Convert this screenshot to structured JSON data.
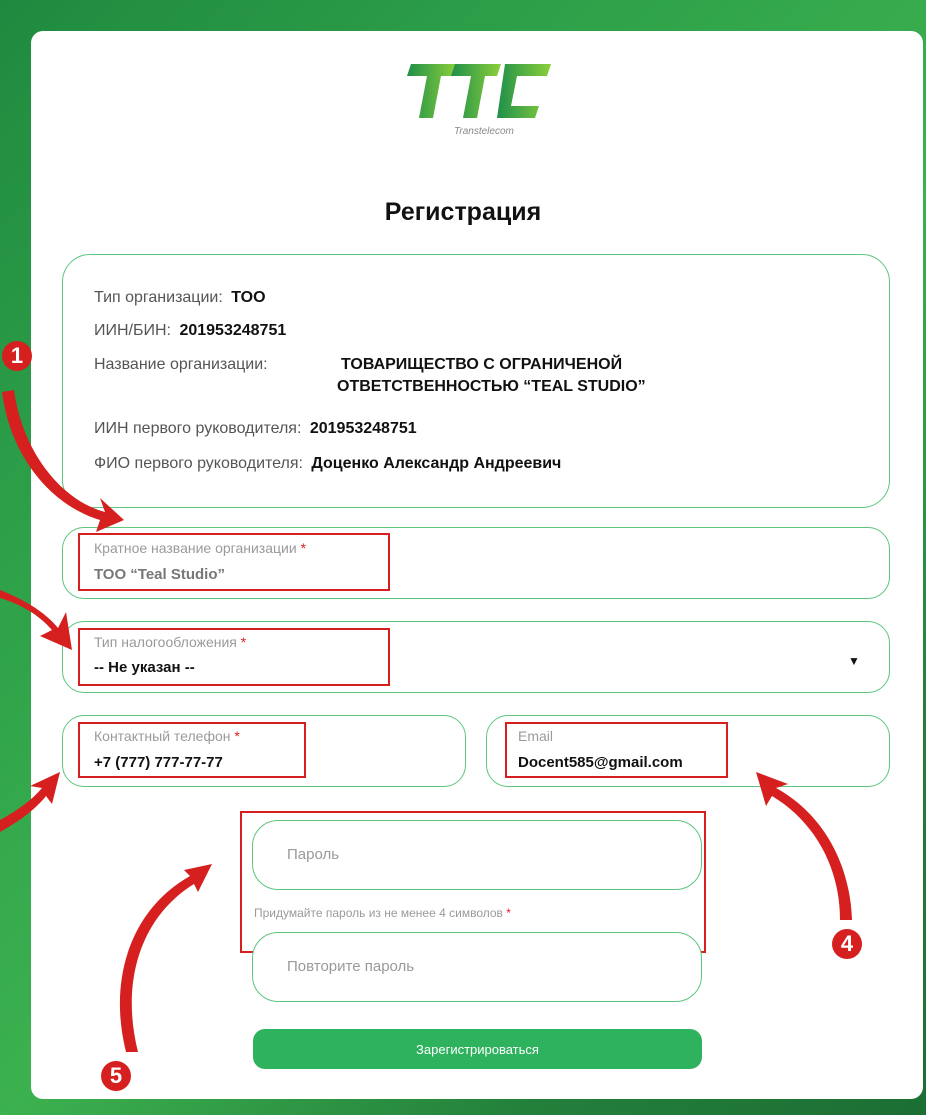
{
  "logo": {
    "text": "Transtelecom"
  },
  "title": "Регистрация",
  "org_info": {
    "type": {
      "label": "Тип организации:",
      "value": "ТОО"
    },
    "iin": {
      "label": "ИИН/БИН:",
      "value": "201953248751"
    },
    "name": {
      "label": "Название организации:",
      "value_line1": "ТОВАРИЩЕСТВО С ОГРАНИЧЕНОЙ",
      "value_line2": "ОТВЕТСТВЕННОСТЬЮ “TEAL STUDIO”"
    },
    "head_iin": {
      "label": "ИИН первого руководителя:",
      "value": "201953248751"
    },
    "head_name": {
      "label": "ФИО первого руководителя:",
      "value": "Доценко Александр Андреевич"
    }
  },
  "form": {
    "short_name": {
      "label": "Кратное название организации",
      "required": "*",
      "value": "ТОО “Teal Studio”"
    },
    "tax": {
      "label": "Тип налогообложения",
      "required": "*",
      "value": "-- Не указан --"
    },
    "phone": {
      "label": "Контактный телефон",
      "required": "*",
      "value": "+7 (777) 777-77-77"
    },
    "email": {
      "label": "Email",
      "value": "Docent585@gmail.com"
    },
    "password": {
      "placeholder": "Пароль"
    },
    "password_hint": {
      "text": "Придумайте пароль из не менее 4 символов",
      "required": "*"
    },
    "password_repeat": {
      "placeholder": "Повторите пароль"
    },
    "submit_label": "Зарегистрироваться"
  },
  "annotations": {
    "n1": "1",
    "n4": "4",
    "n5": "5"
  },
  "colors": {
    "accent": "#2fb25e",
    "border": "#5cc57e",
    "annotation": "#d62020"
  }
}
